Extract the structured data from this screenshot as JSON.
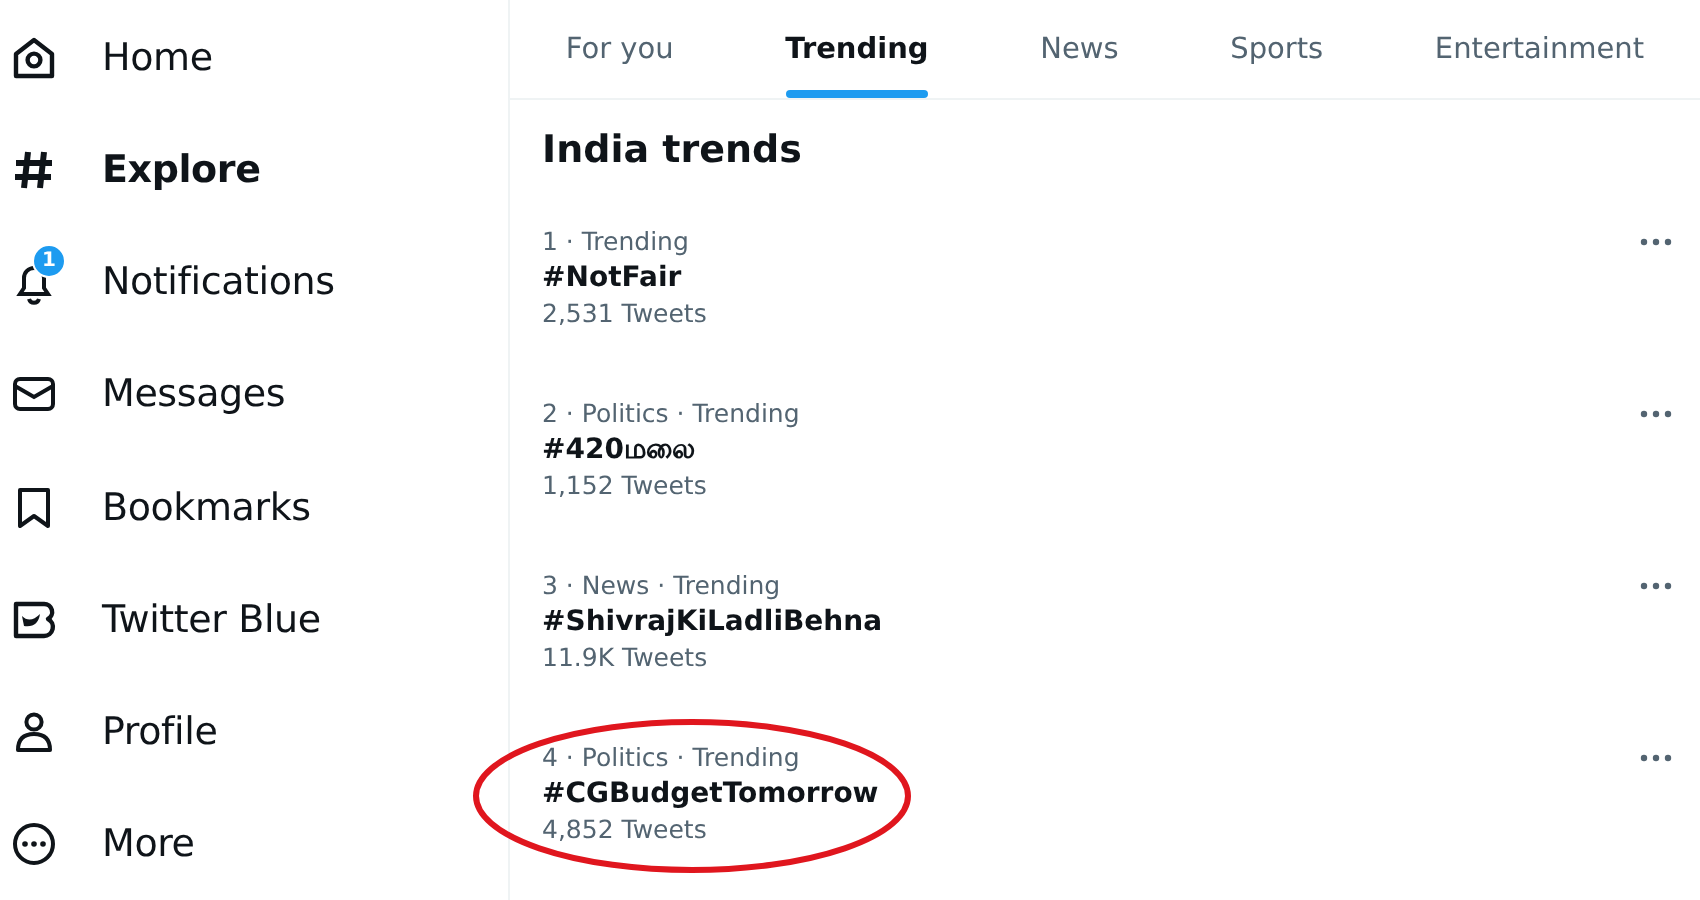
{
  "sidebar": {
    "items": [
      {
        "kind": "home",
        "label": "Home",
        "selected": false
      },
      {
        "kind": "explore",
        "label": "Explore",
        "selected": true
      },
      {
        "kind": "notifications",
        "label": "Notifications",
        "selected": false,
        "badge": "1"
      },
      {
        "kind": "messages",
        "label": "Messages",
        "selected": false
      },
      {
        "kind": "bookmarks",
        "label": "Bookmarks",
        "selected": false
      },
      {
        "kind": "blue",
        "label": "Twitter Blue",
        "selected": false
      },
      {
        "kind": "profile",
        "label": "Profile",
        "selected": false
      },
      {
        "kind": "more",
        "label": "More",
        "selected": false
      }
    ]
  },
  "tabs": [
    {
      "label": "For you",
      "selected": false
    },
    {
      "label": "Trending",
      "selected": true
    },
    {
      "label": "News",
      "selected": false
    },
    {
      "label": "Sports",
      "selected": false
    },
    {
      "label": "Entertainment",
      "selected": false
    }
  ],
  "section_title": "India trends",
  "trends": [
    {
      "meta": "1 · Trending",
      "title": "#NotFair",
      "count": "2,531 Tweets",
      "circled": false
    },
    {
      "meta": "2 · Politics · Trending",
      "title": "#420மலை",
      "count": "1,152 Tweets",
      "circled": false
    },
    {
      "meta": "3 · News · Trending",
      "title": "#ShivrajKiLadliBehna",
      "count": "11.9K Tweets",
      "circled": false
    },
    {
      "meta": "4 · Politics · Trending",
      "title": "#CGBudgetTomorrow",
      "count": "4,852 Tweets",
      "circled": true
    }
  ]
}
